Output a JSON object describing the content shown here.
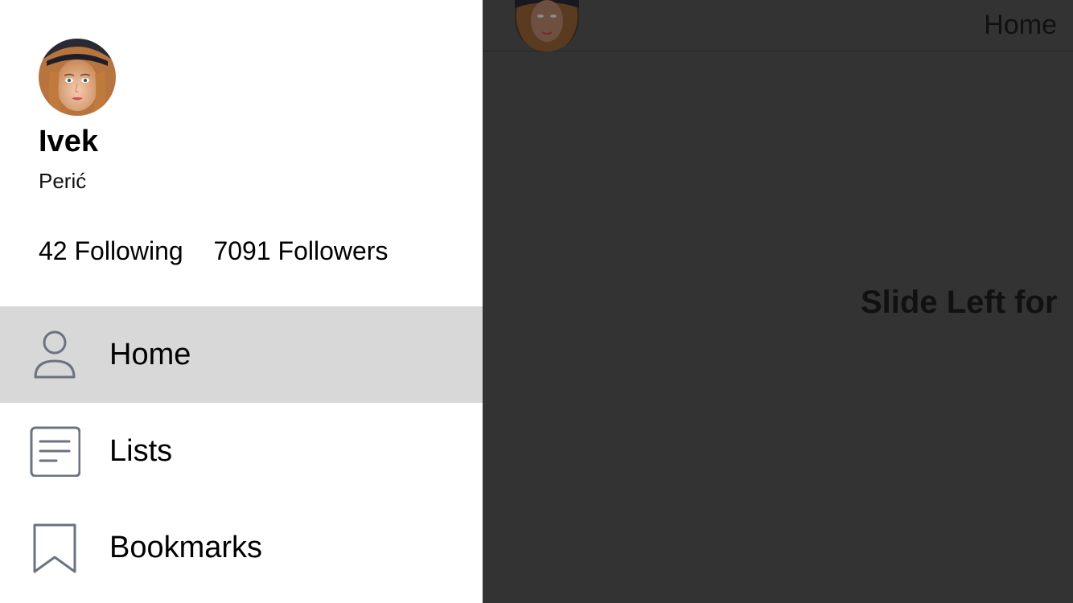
{
  "profile": {
    "first_name": "Ivek",
    "last_name": "Perić",
    "following_count": "42",
    "following_label": "Following",
    "followers_count": "7091",
    "followers_label": "Followers"
  },
  "menu": {
    "items": [
      {
        "label": "Home",
        "icon": "person-icon",
        "active": true
      },
      {
        "label": "Lists",
        "icon": "list-icon",
        "active": false
      },
      {
        "label": "Bookmarks",
        "icon": "bookmark-icon",
        "active": false
      }
    ]
  },
  "main": {
    "title": "Home",
    "body_text": "Slide Left for"
  },
  "colors": {
    "drawer_bg": "#ffffff",
    "active_item_bg": "#d8d8d8",
    "overlay_bg": "#333333",
    "icon_stroke": "#6b7280"
  }
}
